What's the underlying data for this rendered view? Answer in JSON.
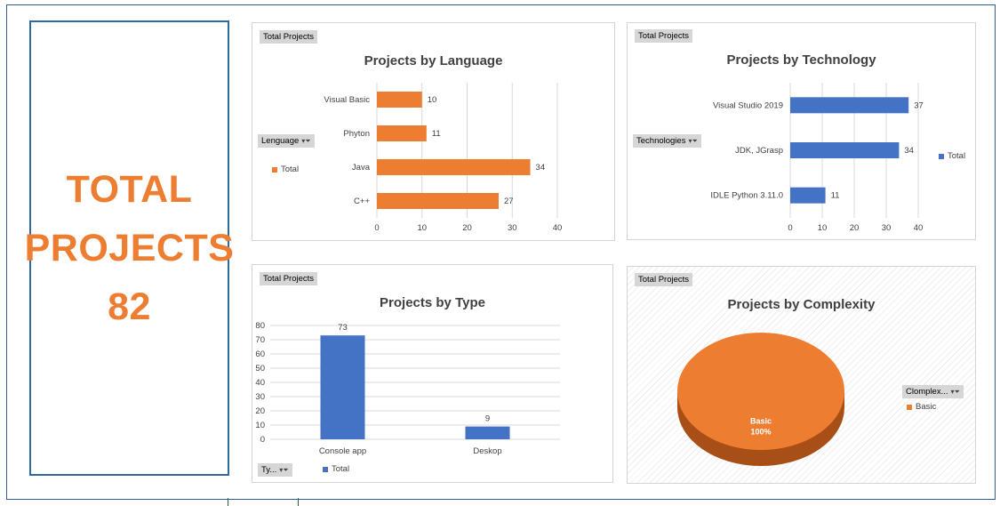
{
  "kpi": {
    "line1": "TOTAL",
    "line2": "PROJECTS",
    "value": "82"
  },
  "colors": {
    "orange": "#ed7d31",
    "blue": "#4472c4",
    "frame": "#2f5e8e"
  },
  "pivot_field": "Total Projects",
  "legend_total": "Total",
  "charts": {
    "language": {
      "filter_label": "Lenguage",
      "filter_icon": "filter-dropdown-icon"
    },
    "technology": {
      "filter_label": "Technologies",
      "filter_icon": "filter-dropdown-icon"
    },
    "type": {
      "filter_label": "Ty...",
      "filter_icon": "filter-dropdown-icon"
    },
    "complexity": {
      "filter_label": "Clomplex...",
      "filter_icon": "filter-dropdown-icon",
      "slice_label": "Basic",
      "slice_pct": "100%",
      "legend_item": "Basic"
    }
  },
  "chart_data": [
    {
      "type": "bar",
      "orientation": "horizontal",
      "title": "Projects by Language",
      "categories": [
        "Visual Basic",
        "Phyton",
        "Java",
        "C++"
      ],
      "values": [
        10,
        11,
        34,
        27
      ],
      "xlim": [
        0,
        40
      ],
      "ticks": [
        0,
        10,
        20,
        30,
        40
      ],
      "color": "#ed7d31",
      "grid": true,
      "legend": "left"
    },
    {
      "type": "bar",
      "orientation": "horizontal",
      "title": "Projects by Technology",
      "categories": [
        "Visual Studio 2019",
        "JDK, JGrasp",
        "IDLE Python 3.11.0"
      ],
      "values": [
        37,
        34,
        11
      ],
      "xlim": [
        0,
        40
      ],
      "ticks": [
        0,
        10,
        20,
        30,
        40
      ],
      "color": "#4472c4",
      "grid": true,
      "legend": "right"
    },
    {
      "type": "bar",
      "orientation": "vertical",
      "title": "Projects by Type",
      "categories": [
        "Console app",
        "Deskop"
      ],
      "values": [
        73,
        9
      ],
      "ylim": [
        0,
        80
      ],
      "ticks": [
        0,
        10,
        20,
        30,
        40,
        50,
        60,
        70,
        80
      ],
      "color": "#4472c4",
      "grid": true,
      "legend": "bottom-left"
    },
    {
      "type": "pie",
      "title": "Projects by Complexity",
      "categories": [
        "Basic"
      ],
      "values": [
        100
      ],
      "color": "#ed7d31",
      "legend": "right"
    }
  ]
}
